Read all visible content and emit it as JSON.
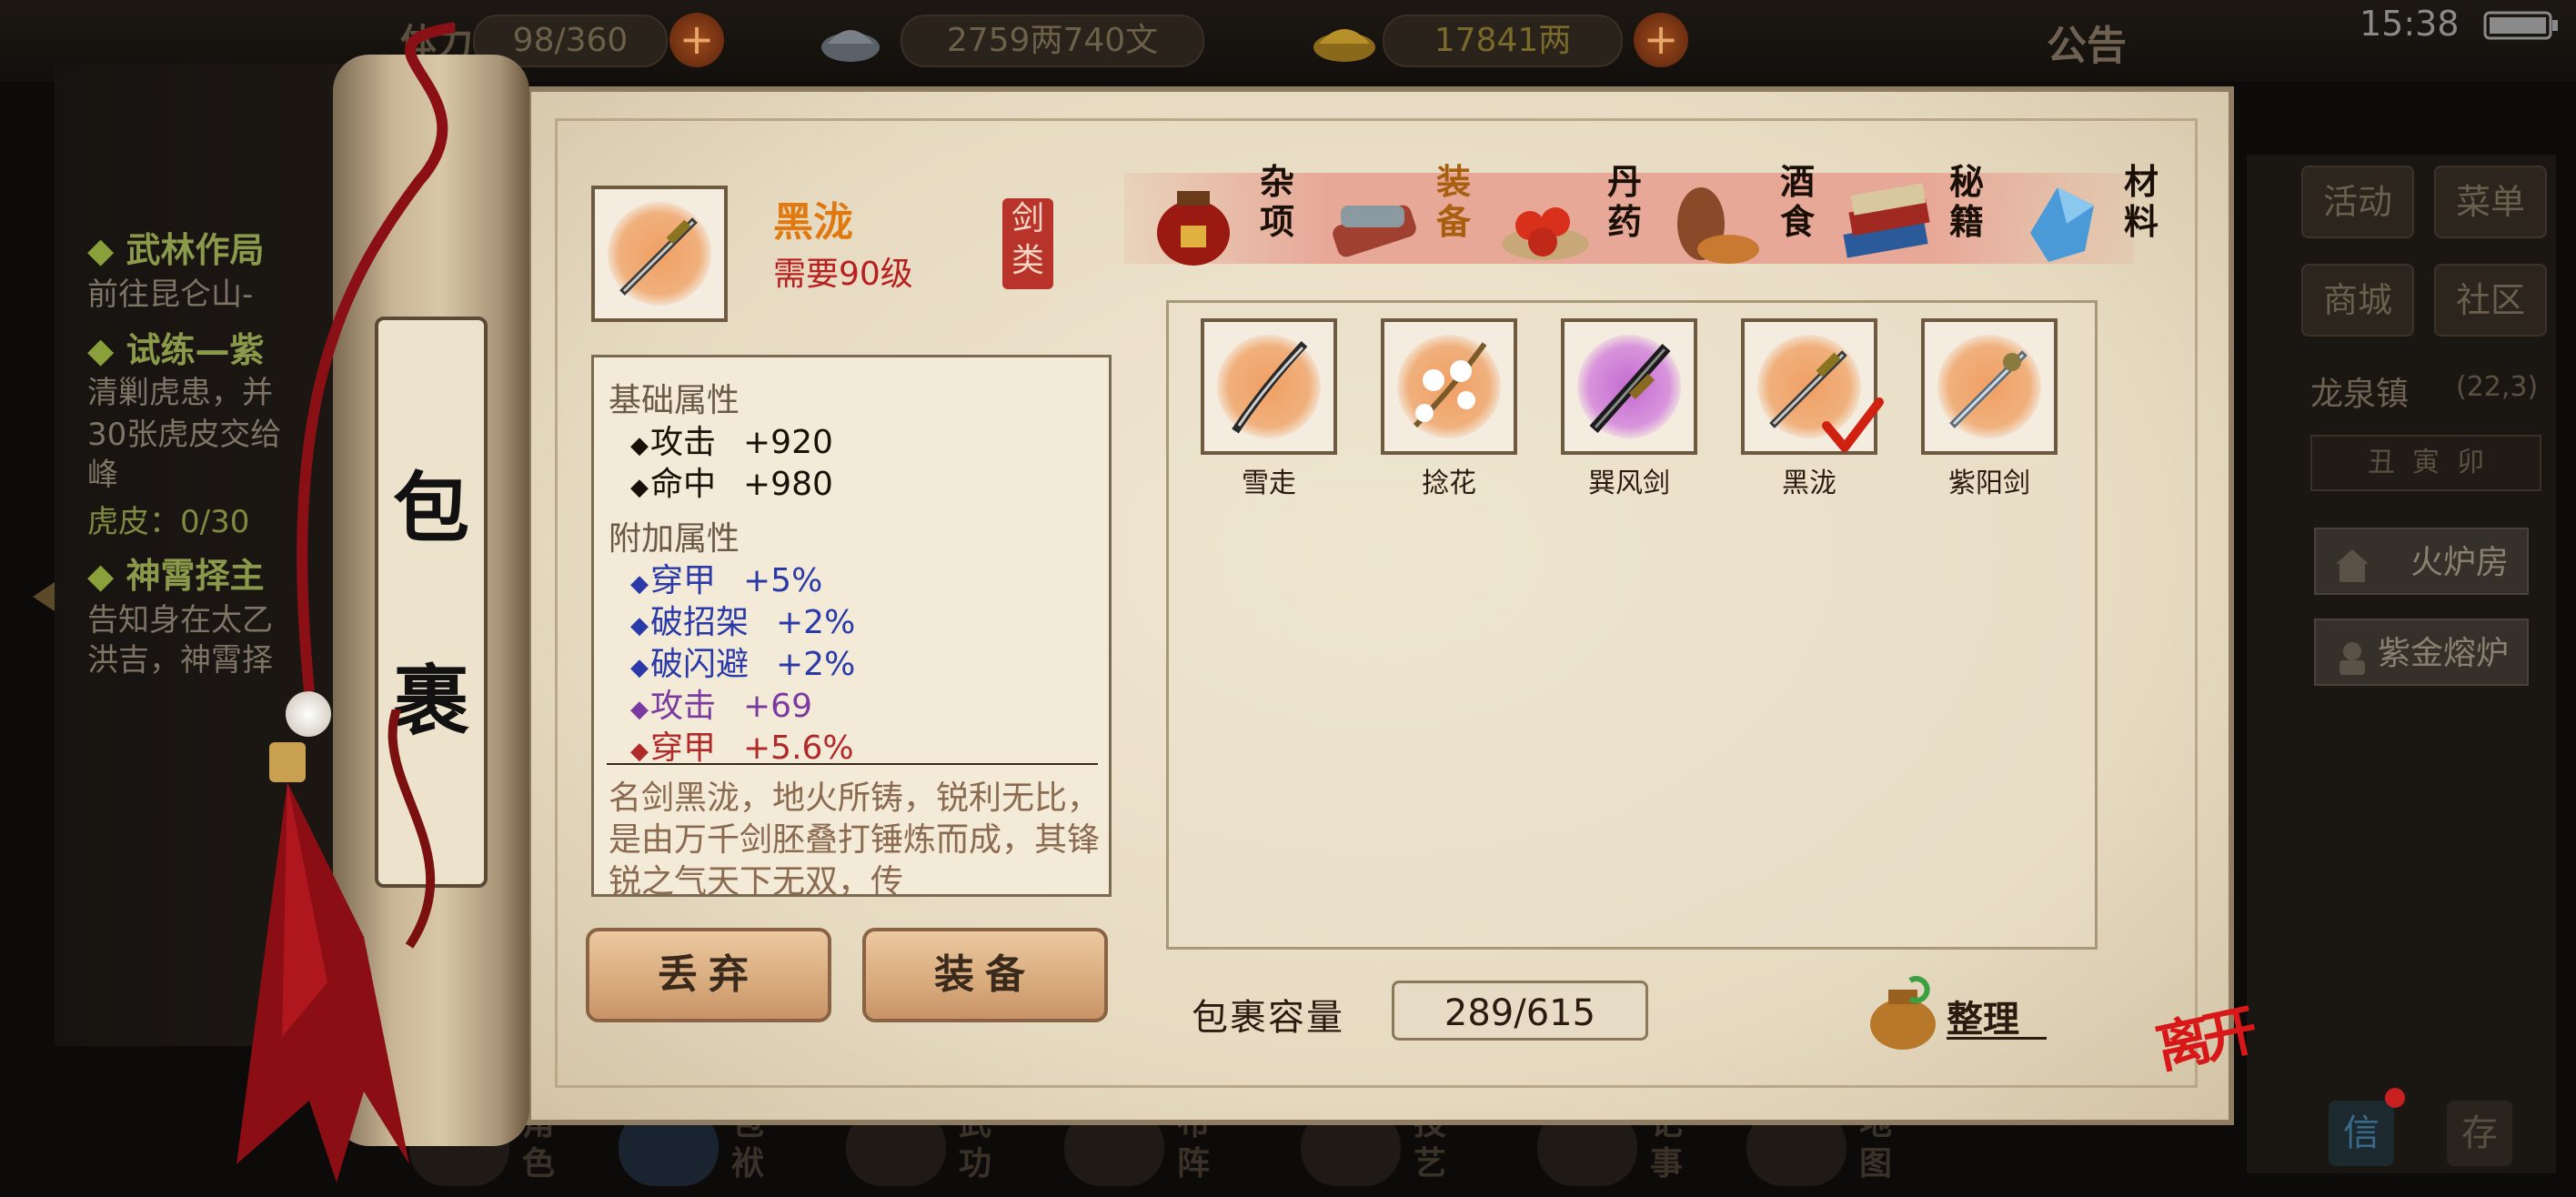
{
  "topbar": {
    "stamina_label": "体力",
    "stamina": "98/360",
    "silver": "2759两740文",
    "gold": "17841两",
    "announcement": "公告",
    "time": "15:38"
  },
  "quests": [
    {
      "title": "武林作局",
      "lines": [
        "前往昆仑山-"
      ]
    },
    {
      "title": "试练—紫",
      "lines": [
        "清剿虎患，并",
        "30张虎皮交给",
        "峰"
      ],
      "progress": "虎皮：0/30"
    },
    {
      "title": "神霄择主",
      "lines": [
        "告知身在太乙",
        "洪吉，神霄择"
      ]
    }
  ],
  "right_panel": {
    "buttons": [
      "活动",
      "菜单",
      "商城",
      "社区"
    ],
    "location": "龙泉镇",
    "location_coords": "(22,3)",
    "clock_dial": "丑  寅  卯",
    "facilities": [
      "火炉房",
      "紫金熔炉"
    ],
    "bottom_icons": [
      "信",
      "存"
    ]
  },
  "scroll_label": [
    "包",
    "裹"
  ],
  "selected_item": {
    "name": "黑泷",
    "requirement": "需要90级",
    "type": "剑类",
    "base_title": "基础属性",
    "base_attrs": [
      {
        "name": "攻击",
        "value": "+920"
      },
      {
        "name": "命中",
        "value": "+980"
      }
    ],
    "extra_title": "附加属性",
    "extra_attrs": [
      {
        "name": "穿甲",
        "value": "+5%",
        "color": "#2a3aa8"
      },
      {
        "name": "破招架",
        "value": "+2%",
        "color": "#2a3aa8"
      },
      {
        "name": "破闪避",
        "value": "+2%",
        "color": "#2a3aa8"
      },
      {
        "name": "攻击",
        "value": "+69",
        "color": "#7a3aa0"
      },
      {
        "name": "穿甲",
        "value": "+5.6%",
        "color": "#b02a2a"
      }
    ],
    "description": "名剑黑泷，地火所铸，锐利无比，是由万千剑胚叠打锤炼而成，其锋锐之气天下无双，传"
  },
  "actions": {
    "discard": "丢弃",
    "equip": "装备"
  },
  "tabs": [
    {
      "label": "杂项",
      "icon": "jar-icon"
    },
    {
      "label": "装备",
      "icon": "equipment-bundle-icon",
      "active": true
    },
    {
      "label": "丹药",
      "icon": "pill-icon"
    },
    {
      "label": "酒食",
      "icon": "wine-food-icon"
    },
    {
      "label": "秘籍",
      "icon": "book-icon"
    },
    {
      "label": "材料",
      "icon": "crystal-icon"
    }
  ],
  "inventory": [
    {
      "name": "雪走",
      "rarity": "orange",
      "icon": "katana-icon"
    },
    {
      "name": "捻花",
      "rarity": "orange",
      "icon": "flower-branch-icon"
    },
    {
      "name": "巽风剑",
      "rarity": "purple",
      "icon": "sword-icon"
    },
    {
      "name": "黑泷",
      "rarity": "orange",
      "icon": "sword-icon",
      "equipped": true
    },
    {
      "name": "紫阳剑",
      "rarity": "orange",
      "icon": "sword-icon"
    }
  ],
  "capacity": {
    "label": "包裹容量",
    "value": "289/615"
  },
  "sort_label": "整理",
  "leave_label": "离开",
  "bottom_nav": [
    "角色",
    "包袱",
    "武功",
    "布阵",
    "技艺",
    "记事",
    "地图"
  ],
  "colors": {
    "accent_orange": "#e07a10",
    "requirement_red": "#b82020",
    "parchment": "#eadfc8"
  }
}
